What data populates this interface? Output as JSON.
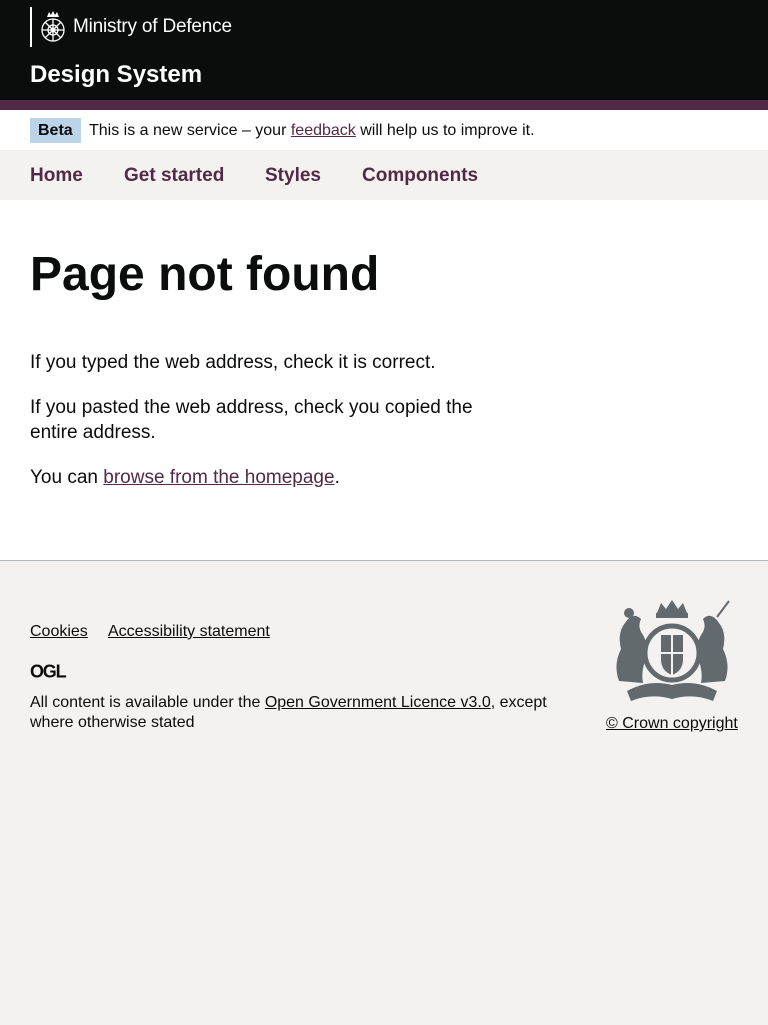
{
  "header": {
    "organisation": "Ministry of Defence",
    "service_name": "Design System",
    "logo_icon": "crest-icon",
    "background": "#0b0c0c",
    "accent": "#532a45"
  },
  "phase_banner": {
    "tag": "Beta",
    "text_before": "This is a new service – your ",
    "link": "feedback",
    "text_after": " will help us to improve it.",
    "tag_color": "#bbd4ea"
  },
  "nav": {
    "items": [
      {
        "label": "Home"
      },
      {
        "label": "Get started"
      },
      {
        "label": "Styles"
      },
      {
        "label": "Components"
      }
    ],
    "link_color": "#532a45"
  },
  "main": {
    "title": "Page not found",
    "paragraphs": [
      "If you typed the web address, check it is correct.",
      "If you pasted the web address, check you copied the entire address."
    ],
    "browse": {
      "prefix": "You can ",
      "link": "browse from the homepage",
      "suffix": "."
    }
  },
  "footer": {
    "links": [
      {
        "label": "Cookies"
      },
      {
        "label": "Accessibility statement"
      }
    ],
    "ogl_logo": "OGL",
    "licence": {
      "prefix": "All content is available under the ",
      "link": "Open Government Licence v3.0",
      "suffix": ", except where otherwise stated"
    },
    "arms_icon": "royal-coat-of-arms-icon",
    "copyright": "© Crown copyright",
    "background": "#f3f2f1"
  }
}
